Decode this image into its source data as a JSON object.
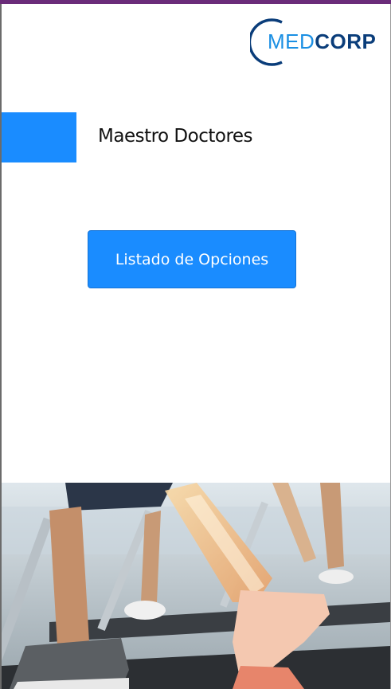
{
  "logo": {
    "part1": "MED",
    "part2": "CORP",
    "colors": {
      "med": "#1a8fe3",
      "corp": "#0a3d7a"
    }
  },
  "header": {
    "title": "Maestro Doctores"
  },
  "main": {
    "options_button_label": "Listado de Opciones"
  },
  "colors": {
    "accent": "#1a8cff",
    "top_bar": "#6b2c7a"
  },
  "hero": {
    "icon": "treadmill-runners-photo"
  }
}
